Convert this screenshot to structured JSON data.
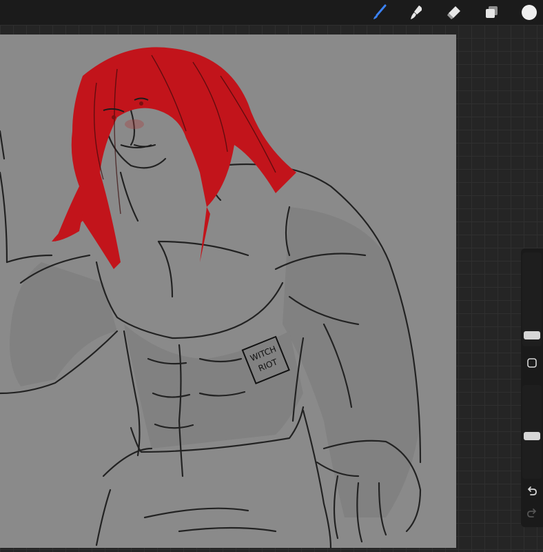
{
  "toolbar": {
    "tools": [
      {
        "icon": "brush-icon",
        "active": true,
        "color": "#3b82f6"
      },
      {
        "icon": "smudge-icon",
        "active": false
      },
      {
        "icon": "eraser-icon",
        "active": false
      },
      {
        "icon": "layers-icon",
        "active": false
      },
      {
        "icon": "color-swatch-icon",
        "active": false,
        "color": "#eeeeee"
      }
    ]
  },
  "canvas": {
    "signature_text": "WITCH RIOT",
    "hair_color": "#c2141b",
    "paper_color": "#8a8a8a"
  },
  "sidebar": {
    "brush_size_fraction": 0.93,
    "opacity_fraction": 0.57,
    "modify_button_icon": "square-icon",
    "undo_icon": "undo-icon",
    "redo_icon": "redo-icon"
  }
}
